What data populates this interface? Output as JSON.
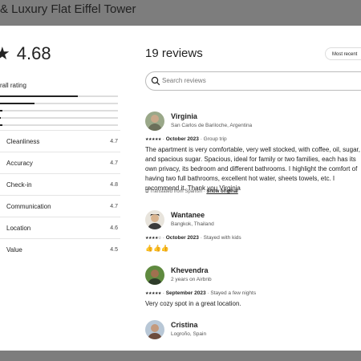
{
  "page": {
    "title": "& Luxury Flat Eiffel Tower"
  },
  "ratings": {
    "overall_value": "4.68",
    "overall_label": "rall rating",
    "histogram": [
      0.66,
      0.29,
      0.02,
      0.01,
      0.02
    ],
    "categories": [
      {
        "label": "Cleanliness",
        "value": "4.7"
      },
      {
        "label": "Accuracy",
        "value": "4.7"
      },
      {
        "label": "Check-in",
        "value": "4.8"
      },
      {
        "label": "Communication",
        "value": "4.7"
      },
      {
        "label": "Location",
        "value": "4.6"
      },
      {
        "label": "Value",
        "value": "4.5"
      }
    ]
  },
  "reviews_panel": {
    "title": "19 reviews",
    "sort_label": "Most recent",
    "search_placeholder": "Search reviews"
  },
  "reviews": [
    {
      "name": "Virginia",
      "location": "San Carlos de Bariloche, Argentina",
      "stars": "★★★★★",
      "date": "October 2023",
      "trip": "Group trip",
      "text": "The apartment is very comfortable, very well stocked, with coffee, oil, sugar, and spacious sugar. Spacious, ideal for family or two families, each has its own privacy, its bedroom and different bathrooms. I highlight the comfort of having two full bathrooms, excellent hot water, sheets towels, etc. I recommend it. Thank you Virginia",
      "translated": "Translated from Spanish",
      "show_original": "Show original"
    },
    {
      "name": "Wantanee",
      "location": "Bangkok, Thailand",
      "stars": "★★★★☆",
      "date": "October 2023",
      "trip": "Stayed with kids",
      "text": "👍👍👍"
    },
    {
      "name": "Khevendra",
      "location": "2 years on Airbnb",
      "stars": "★★★★★",
      "date": "September 2023",
      "trip": "Stayed a few nights",
      "text": "Very cozy spot in a great location."
    },
    {
      "name": "Cristina",
      "location": "Logroño, Spain"
    }
  ],
  "colors": {
    "accent": "#222222",
    "backdrop": "#7d7d7d",
    "divider": "#e5e5e5"
  }
}
